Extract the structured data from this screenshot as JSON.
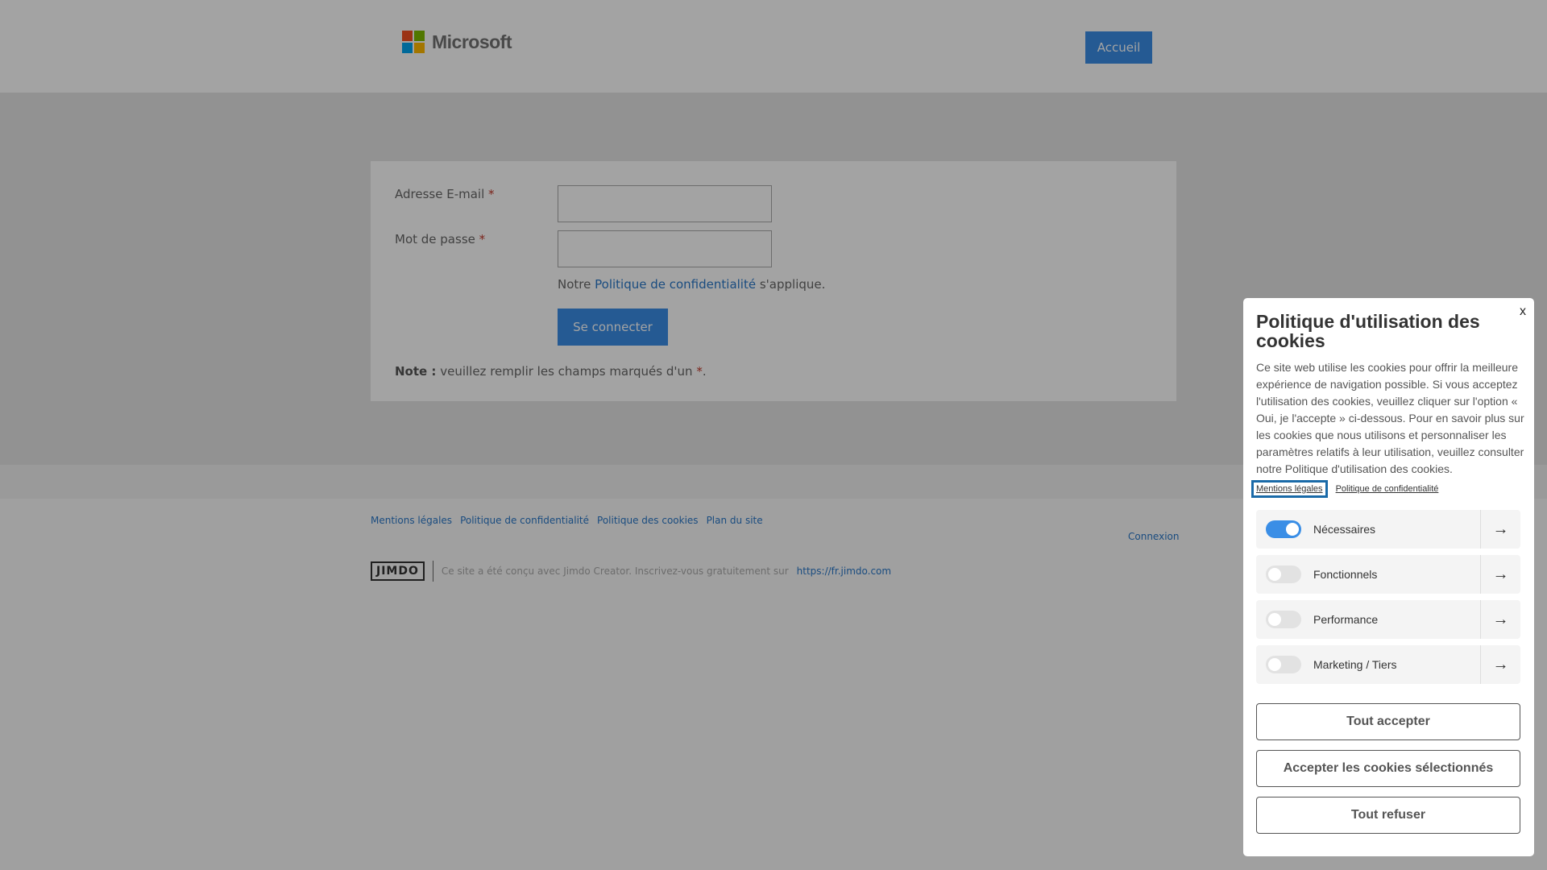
{
  "header": {
    "logo_text": "Microsoft",
    "home_label": "Accueil",
    "logo_colors": [
      "#f25022",
      "#7fba00",
      "#00a4ef",
      "#ffb900"
    ]
  },
  "form": {
    "email_label": "Adresse E-mail",
    "password_label": "Mot de passe",
    "required_mark": "*",
    "privacy_prefix": "Notre",
    "privacy_link": "Politique de confidentialité",
    "privacy_suffix": "s'applique.",
    "submit_label": "Se connecter",
    "note_bold": "Note :",
    "note_text": "veuillez remplir les champs marqués d'un",
    "note_mark": "*",
    "note_end": "."
  },
  "footer": {
    "links": [
      "Mentions légales",
      "Politique de confidentialité",
      "Politique des cookies",
      "Plan du site"
    ],
    "connexion": "Connexion",
    "jimdo_logo": "JIMDO",
    "jimdo_text": "Ce site a été conçu avec Jimdo Creator. Inscrivez-vous gratuitement sur",
    "jimdo_url": "https://fr.jimdo.com"
  },
  "cookie": {
    "close": "x",
    "title": "Politique d'utilisation des cookies",
    "body": "Ce site web utilise les cookies pour offrir la meilleure expérience de navigation possible. Si vous acceptez l'utilisation des cookies, veuillez cliquer sur l'option « Oui, je l'accepte » ci-dessous. Pour en savoir plus sur les cookies que nous utilisons et personnaliser les paramètres relatifs à leur utilisation, veuillez consulter notre Politique d'utilisation des cookies.",
    "link_legal": "Mentions légales",
    "link_privacy": "Politique de confidentialité",
    "categories": [
      {
        "label": "Nécessaires",
        "enabled": true
      },
      {
        "label": "Fonctionnels",
        "enabled": false
      },
      {
        "label": "Performance",
        "enabled": false
      },
      {
        "label": "Marketing / Tiers",
        "enabled": false
      }
    ],
    "accept_all": "Tout accepter",
    "accept_selected": "Accepter les cookies sélectionnés",
    "refuse_all": "Tout refuser",
    "accent": "#3a8ee6"
  }
}
